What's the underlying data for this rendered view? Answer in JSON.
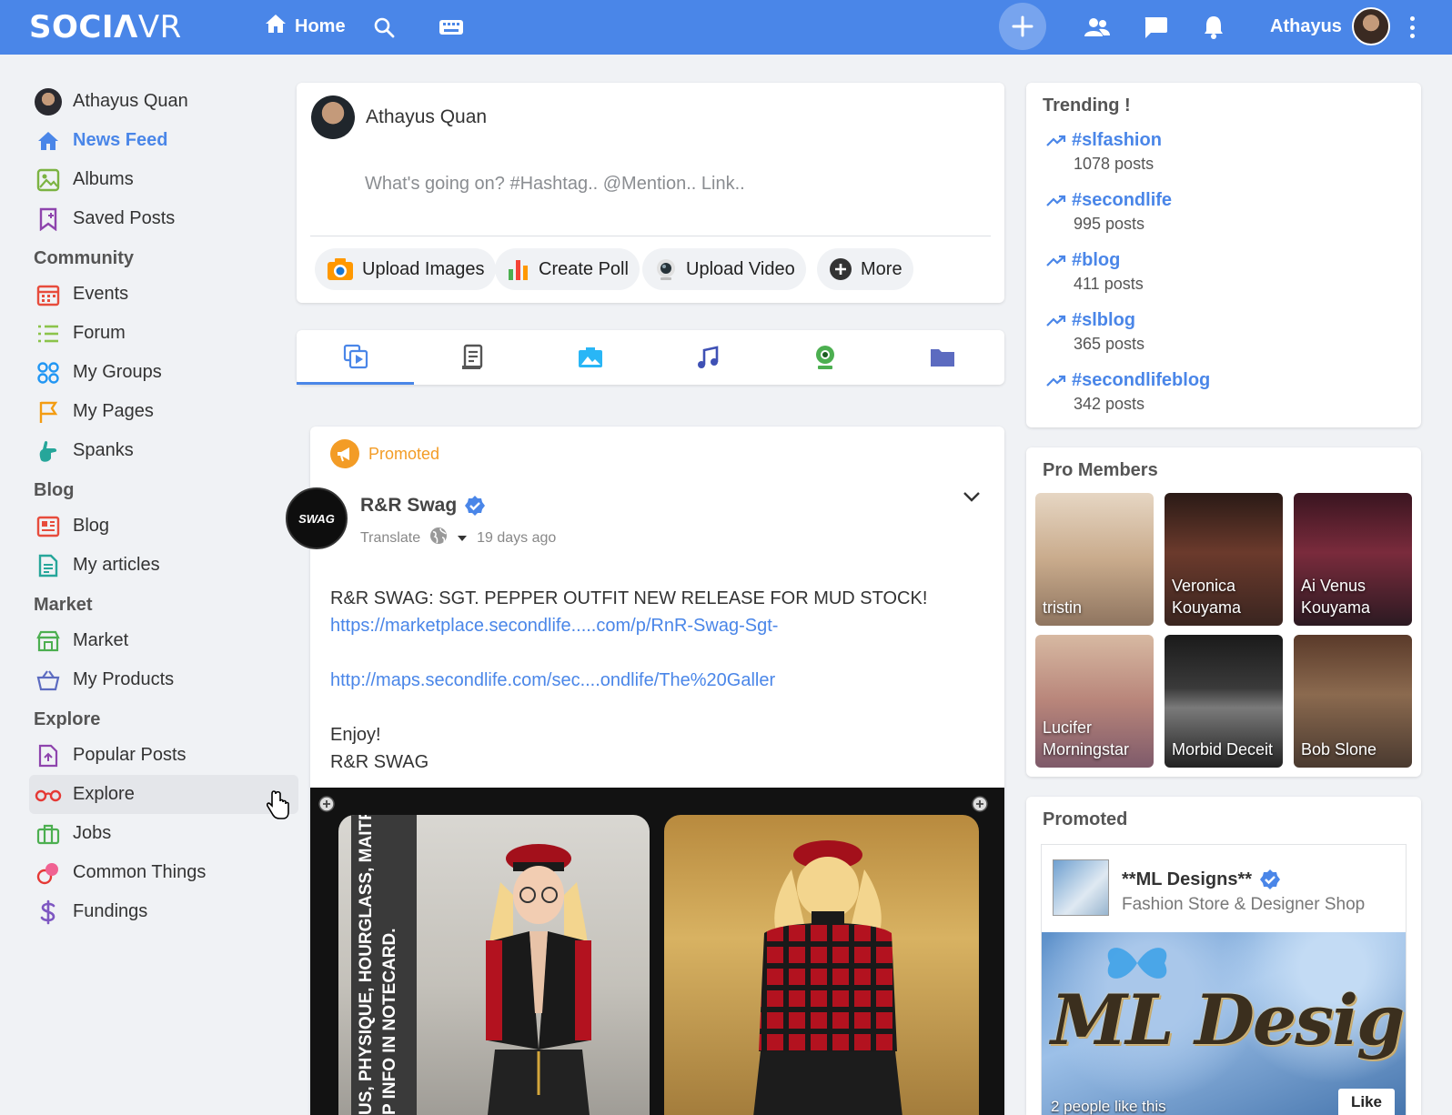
{
  "brand": {
    "logo_bold": "SOCI",
    "logo_a": "Λ",
    "logo_light": "VR"
  },
  "topbar": {
    "home_label": "Home",
    "user_name": "Athayus"
  },
  "sidebar": {
    "profile_name": "Athayus Quan",
    "main_items": [
      {
        "label": "News Feed",
        "icon": "home-icon"
      },
      {
        "label": "Albums",
        "icon": "albums-icon"
      },
      {
        "label": "Saved Posts",
        "icon": "bookmark-icon"
      }
    ],
    "sections": [
      {
        "title": "Community",
        "items": [
          {
            "label": "Events",
            "icon": "calendar-icon"
          },
          {
            "label": "Forum",
            "icon": "list-icon"
          },
          {
            "label": "My Groups",
            "icon": "groups-icon"
          },
          {
            "label": "My Pages",
            "icon": "flag-icon"
          },
          {
            "label": "Spanks",
            "icon": "hand-icon"
          }
        ]
      },
      {
        "title": "Blog",
        "items": [
          {
            "label": "Blog",
            "icon": "blog-icon"
          },
          {
            "label": "My articles",
            "icon": "article-icon"
          }
        ]
      },
      {
        "title": "Market",
        "items": [
          {
            "label": "Market",
            "icon": "store-icon"
          },
          {
            "label": "My Products",
            "icon": "basket-icon"
          }
        ]
      },
      {
        "title": "Explore",
        "items": [
          {
            "label": "Popular Posts",
            "icon": "popular-icon"
          },
          {
            "label": "Explore",
            "icon": "glasses-icon"
          },
          {
            "label": "Jobs",
            "icon": "briefcase-icon"
          },
          {
            "label": "Common Things",
            "icon": "common-icon"
          },
          {
            "label": "Fundings",
            "icon": "dollar-icon"
          }
        ]
      }
    ]
  },
  "composer": {
    "user_name": "Athayus Quan",
    "placeholder": "What's going on? #Hashtag.. @Mention.. Link..",
    "buttons": [
      "Upload Images",
      "Create Poll",
      "Upload Video",
      "More"
    ]
  },
  "post": {
    "promoted_label": "Promoted",
    "author": "R&R Swag",
    "avatar_text": "SWAG",
    "translate_label": "Translate",
    "time_ago": "19 days ago",
    "headline": "R&R SWAG: SGT. PEPPER OUTFIT NEW RELEASE FOR MUD STOCK!",
    "link1": "https://marketplace.secondlife.....com/p/RnR-Swag-Sgt-",
    "link2": "http://maps.secondlife.com/sec....ondlife/The%20Galler",
    "line_enjoy": "Enjoy!",
    "signature": "R&R SWAG",
    "image_text_1": "US, PHYSIQUE, HOURGLASS, MAITREYA",
    "image_text_2": "P INFO IN NOTECARD."
  },
  "trending": {
    "title": "Trending !",
    "items": [
      {
        "tag": "#slfashion",
        "count": "1078 posts"
      },
      {
        "tag": "#secondlife",
        "count": "995 posts"
      },
      {
        "tag": "#blog",
        "count": "411 posts"
      },
      {
        "tag": "#slblog",
        "count": "365 posts"
      },
      {
        "tag": "#secondlifeblog",
        "count": "342 posts"
      }
    ]
  },
  "pro_members": {
    "title": "Pro Members",
    "members": [
      {
        "name": "tristin",
        "color": "#c9ab8c"
      },
      {
        "name": "Veronica Kouyama",
        "color": "#6b3a2c"
      },
      {
        "name": "Ai Venus Kouyama",
        "color": "#7a2b3c"
      },
      {
        "name": "Lucifer Morningstar",
        "color": "#b8857a"
      },
      {
        "name": "Morbid Deceit",
        "color": "#3a3a3a"
      },
      {
        "name": "Bob Slone",
        "color": "#8b6a4f"
      }
    ]
  },
  "promoted_box": {
    "title": "Promoted",
    "shop_name": "**ML Designs**",
    "shop_sub": "Fashion Store & Designer Shop",
    "banner_text": "ML Designs",
    "likes": "2 people like this",
    "like_button": "Like"
  },
  "colors": {
    "accent": "#4a86e8",
    "promoted": "#f39c26",
    "background": "#f0f2f5"
  }
}
